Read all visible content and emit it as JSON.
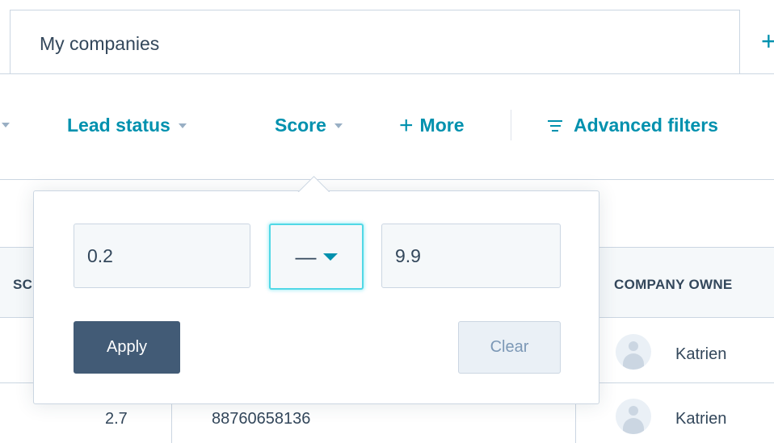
{
  "views": {
    "active_tab_label": "My companies",
    "add_view_icon": "plus-icon"
  },
  "filters": {
    "lead_status_label": "Lead status",
    "score_label": "Score",
    "more_label": "More",
    "more_icon": "plus-icon",
    "advanced_filters_label": "Advanced filters",
    "advanced_filters_icon": "filter-lines-icon"
  },
  "table": {
    "columns": [
      "SC",
      "COMPANY OWNE"
    ],
    "rows": [
      {
        "score": "",
        "phone": "",
        "owner": "Katrien"
      },
      {
        "score": "2.7",
        "phone": "88760658136",
        "owner": "Katrien"
      }
    ]
  },
  "score_filter_popover": {
    "min_value": "0.2",
    "operator": "—",
    "max_value": "9.9",
    "apply_label": "Apply",
    "clear_label": "Clear"
  },
  "colors": {
    "link_teal": "#0091ae",
    "text_dark": "#33475b",
    "apply_bg": "#425b76",
    "focus_ring": "#51d8e6",
    "border": "#cbd6e2"
  }
}
